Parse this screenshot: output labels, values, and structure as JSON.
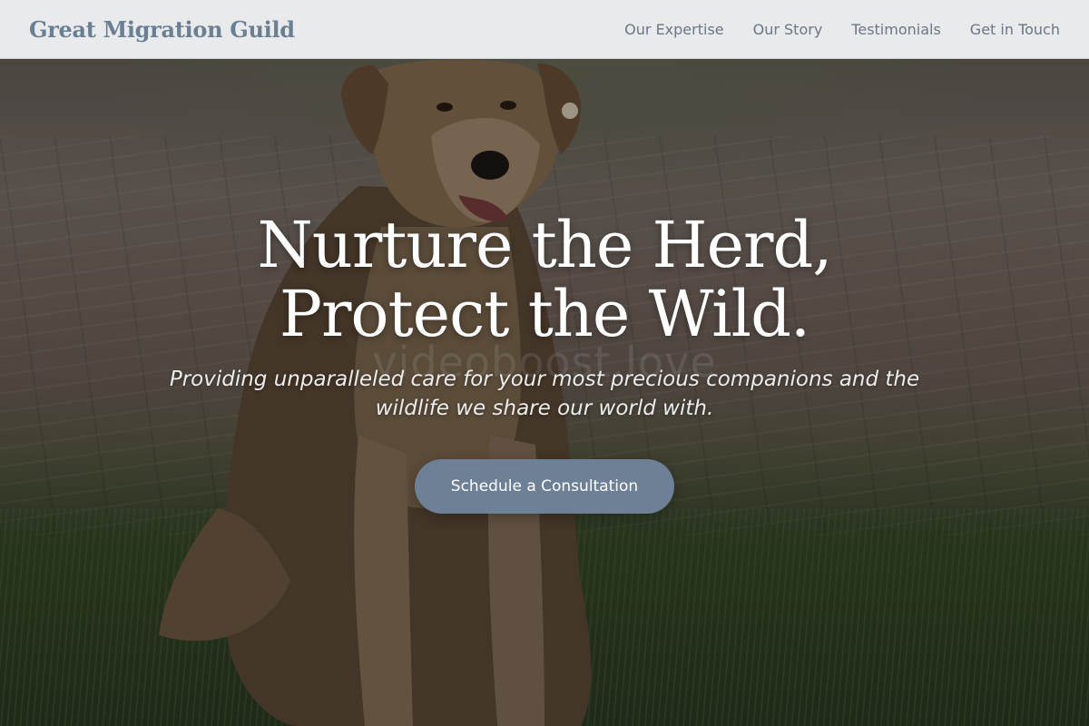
{
  "brand": {
    "name": "Great Migration Guild",
    "color": "#6b7f93"
  },
  "nav": {
    "items": [
      {
        "label": "Our Expertise"
      },
      {
        "label": "Our Story"
      },
      {
        "label": "Testimonials"
      },
      {
        "label": "Get in Touch"
      }
    ]
  },
  "hero": {
    "headline": "Nurture the Herd, Protect the Wild.",
    "subtitle": "Providing unparalleled care for your most precious companions and the wildlife we share our world with.",
    "cta_label": "Schedule a Consultation",
    "cta_color": "#6e8096",
    "watermark": "videoboost.love",
    "background_image": "dog-sitting-on-brick-path-with-grass"
  }
}
